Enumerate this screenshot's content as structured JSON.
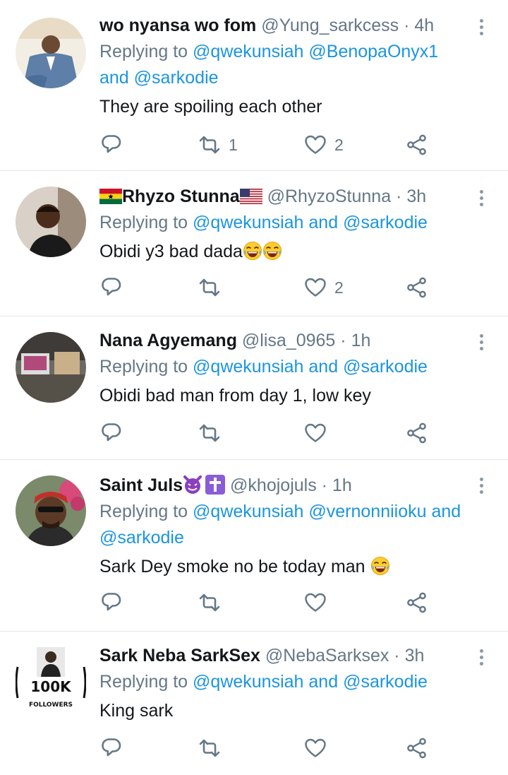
{
  "tweets": [
    {
      "name": "wo nyansa wo fom",
      "handle": "@Yung_sarkcess",
      "time": "4h",
      "replying_prefix": "Replying to ",
      "replying_line1": "@qwekunsiah @BenopaOnyx1",
      "replying_line2_and": "and ",
      "replying_line2_mention": "@sarkodie",
      "text": "They are spoiling each other",
      "retweets": "1",
      "likes": "2"
    },
    {
      "name": "Rhyzo Stunna",
      "handle": "@RhyzoStunna",
      "time": "3h",
      "replying_prefix": "Replying to ",
      "replying_m1": "@qwekunsiah",
      "replying_and": " and ",
      "replying_m2": "@sarkodie",
      "text": "Obidi y3 bad dada",
      "retweets": "",
      "likes": "2"
    },
    {
      "name": "Nana Agyemang",
      "handle": "@lisa_0965",
      "time": "1h",
      "replying_prefix": "Replying to ",
      "replying_m1": "@qwekunsiah",
      "replying_and": " and ",
      "replying_m2": "@sarkodie",
      "text": "Obidi bad man from day 1, low key",
      "retweets": "",
      "likes": ""
    },
    {
      "name": "Saint Juls",
      "handle": "@khojojuls",
      "time": "1h",
      "replying_prefix": "Replying to ",
      "replying_line1": "@qwekunsiah @vernonniioku",
      "replying_line1_and": " and",
      "replying_line2_mention": "@sarkodie",
      "text": "Sark Dey smoke no be today man ",
      "retweets": "",
      "likes": ""
    },
    {
      "name": "Sark Neba SarkSex",
      "handle": "@NebaSarksex",
      "time": "3h",
      "replying_prefix": "Replying to ",
      "replying_m1": "@qwekunsiah",
      "replying_and": " and ",
      "replying_m2": "@sarkodie",
      "text": "King sark",
      "retweets": "",
      "likes": "",
      "avatar_badge": "100K",
      "avatar_badge_sub": "FOLLOWERS"
    }
  ],
  "separator": " · ",
  "colors": {
    "link": "#1b95e0",
    "muted": "#657786",
    "divider": "#e1e8ed"
  },
  "icons": [
    "reply-icon",
    "retweet-icon",
    "like-icon",
    "share-icon",
    "more-icon"
  ]
}
